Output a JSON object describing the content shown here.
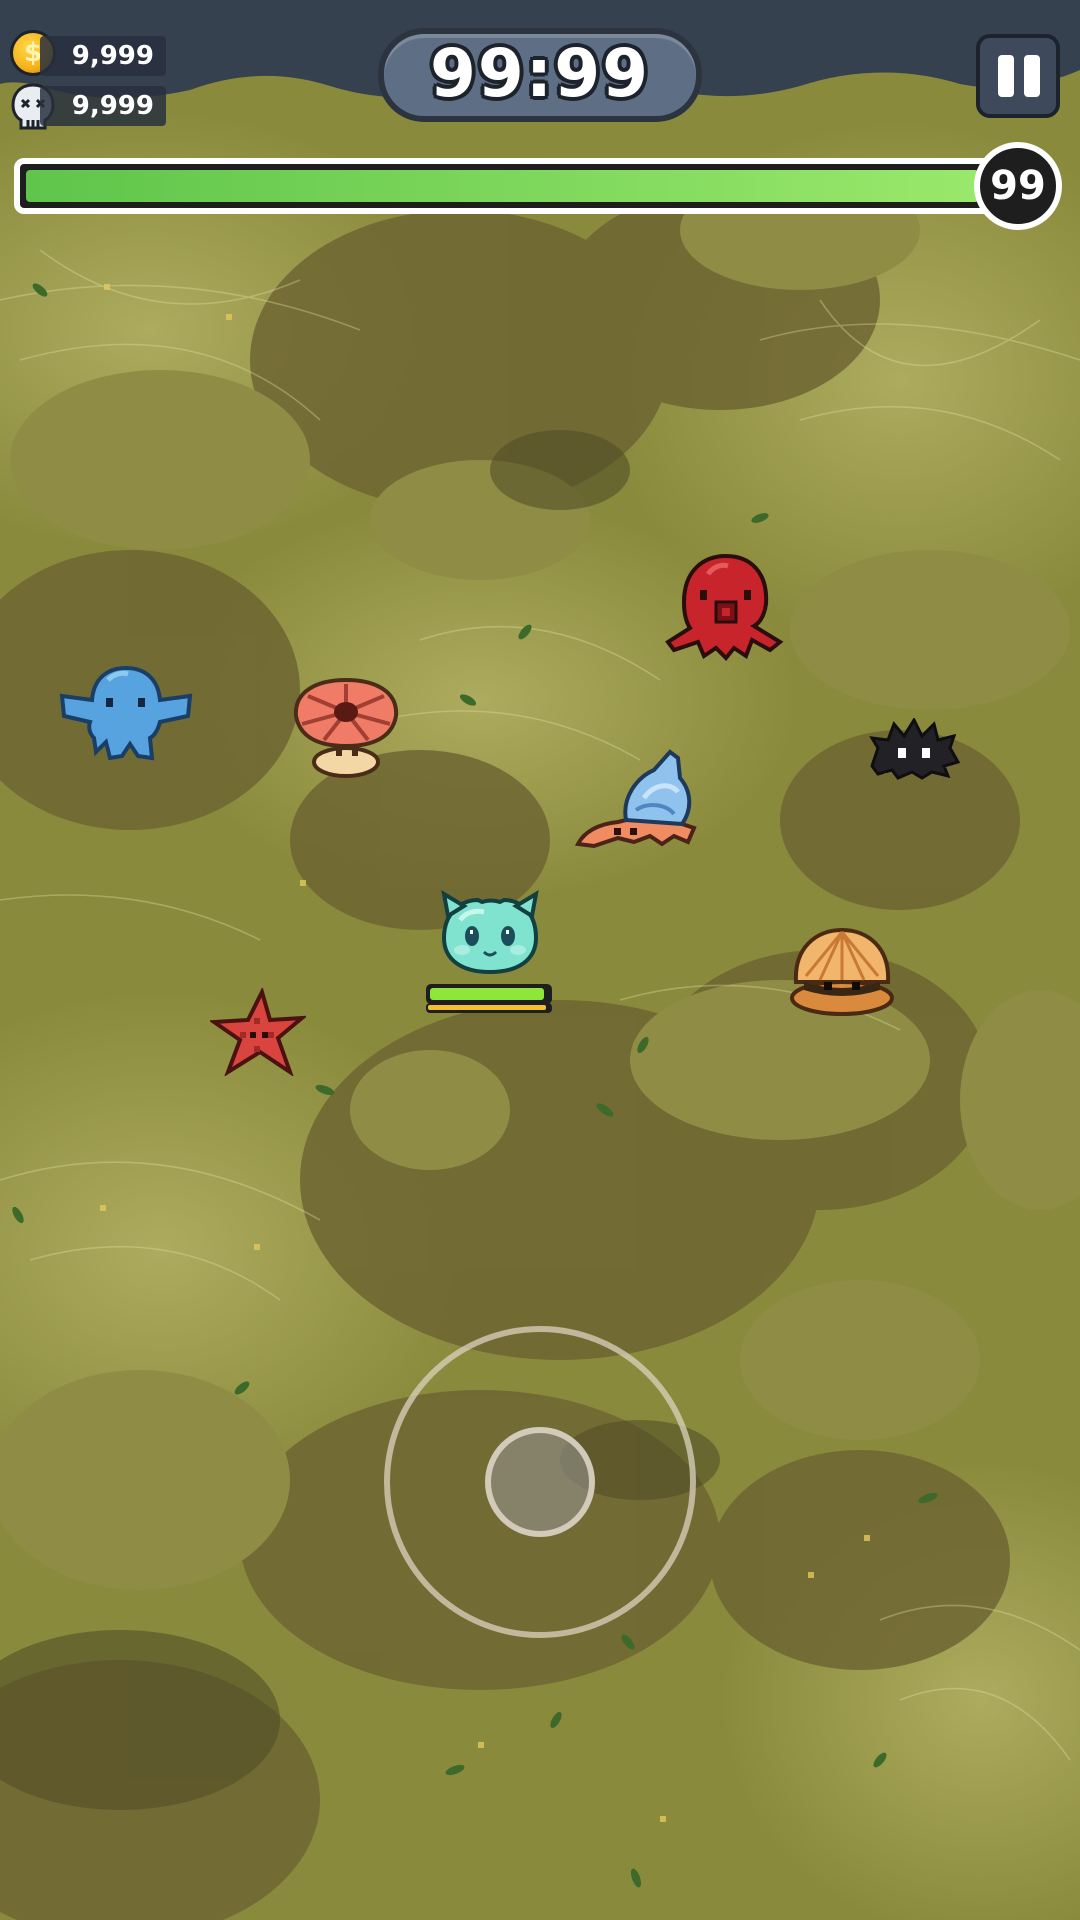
{
  "hud": {
    "coins": "9,999",
    "coin_icon_glyph": "$",
    "kills": "9,999",
    "timer": "99:99",
    "level": "99",
    "xp_progress": 0.965
  },
  "player": {
    "hp_fraction": 0.97,
    "secondary_fraction": 0.97,
    "color": "#7fe3cf"
  },
  "icons": {
    "coin": "coin-icon",
    "kills": "skull-icon",
    "pause": "pause-icon"
  },
  "enemies": [
    "red-octopus",
    "blue-octopus",
    "pink-mushroom",
    "hermit-crab",
    "black-sea-urchin",
    "orange-clam",
    "red-starfish"
  ],
  "colors": {
    "hud_dark": "#2c3440",
    "timer_fill": "#5e6f85",
    "xp_green": "#7ad65a",
    "ground": "#8a8a3c"
  }
}
